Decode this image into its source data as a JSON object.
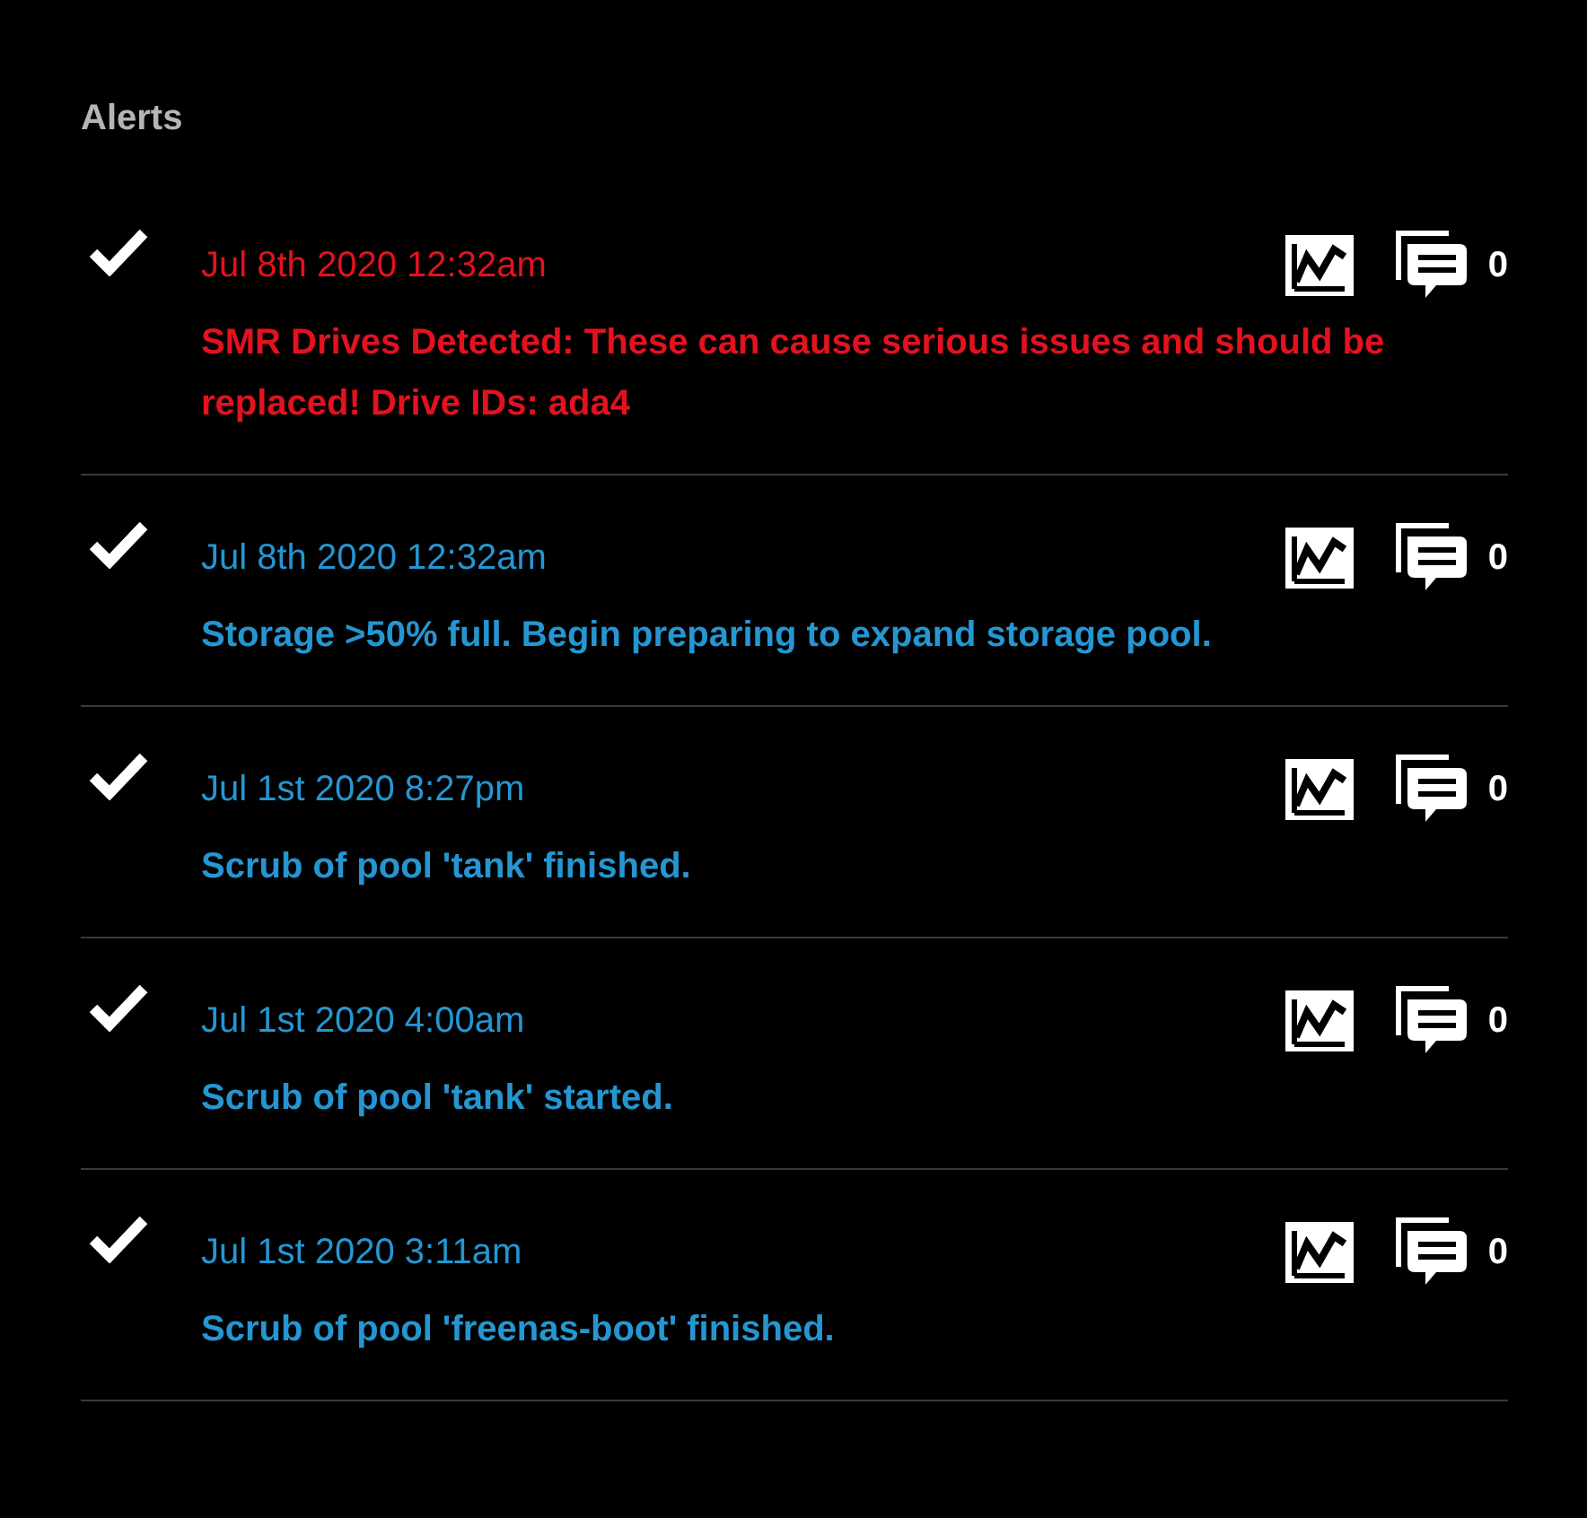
{
  "title": "Alerts",
  "alerts": [
    {
      "time": "Jul 8th 2020 12:32am",
      "message": "SMR Drives Detected: These can cause serious issues and should be replaced! Drive IDs: ada4",
      "color": "#e3121e",
      "comments": "0"
    },
    {
      "time": "Jul 8th 2020 12:32am",
      "message": "Storage >50% full. Begin preparing to expand storage pool.",
      "color": "#2596d1",
      "comments": "0"
    },
    {
      "time": "Jul 1st 2020 8:27pm",
      "message": "Scrub of pool 'tank' finished.",
      "color": "#2596d1",
      "comments": "0"
    },
    {
      "time": "Jul 1st 2020 4:00am",
      "message": "Scrub of pool 'tank' started.",
      "color": "#2596d1",
      "comments": "0"
    },
    {
      "time": "Jul 1st 2020 3:11am",
      "message": "Scrub of pool 'freenas-boot' finished.",
      "color": "#2596d1",
      "comments": "0"
    }
  ]
}
